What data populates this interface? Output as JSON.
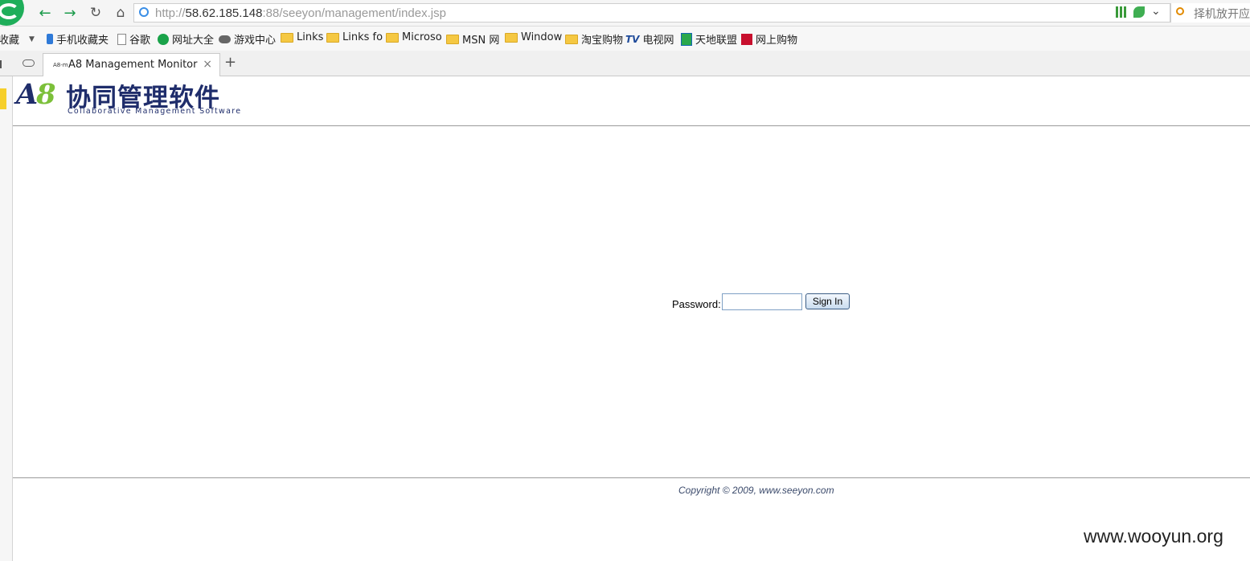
{
  "browser": {
    "url_prefix": "http://",
    "url_host": "58.62.185.148",
    "url_rest": ":88/seeyon/management/index.jsp",
    "search_placeholder": "择机放开应",
    "bookmarks": [
      {
        "label": "收藏",
        "icon": "star-icon"
      },
      {
        "label": "手机收藏夹",
        "icon": "phone-icon"
      },
      {
        "label": "谷歌",
        "icon": "page-icon"
      },
      {
        "label": "网址大全",
        "icon": "plus-globe-icon"
      },
      {
        "label": "游戏中心",
        "icon": "gamepad-icon"
      },
      {
        "label": "Links",
        "icon": "folder-icon"
      },
      {
        "label": "Links fo",
        "icon": "folder-icon"
      },
      {
        "label": "Microso",
        "icon": "folder-icon"
      },
      {
        "label": "MSN 网",
        "icon": "folder-icon"
      },
      {
        "label": "Window",
        "icon": "folder-icon"
      },
      {
        "label": "淘宝购物",
        "icon": "folder-icon"
      },
      {
        "label": "电视网",
        "icon": "tv-icon"
      },
      {
        "label": "天地联盟",
        "icon": "earth-icon"
      },
      {
        "label": "网上购物",
        "icon": "shop-icon"
      }
    ],
    "tab": {
      "title": "A8 Management Monitor",
      "favicon": "A8-m",
      "close": "×"
    },
    "new_tab": "+"
  },
  "header": {
    "logo_mark_a": "A",
    "logo_mark_8": "8",
    "logo_cn": "协同管理软件",
    "logo_en": "Collaborative Management Software"
  },
  "login": {
    "password_label": "Password:",
    "password_value": "",
    "signin_label": "Sign In"
  },
  "footer": {
    "copyright": "Copyright © 2009, www.seeyon.com"
  },
  "watermark": "www.wooyun.org",
  "colors": {
    "brand_navy": "#1f2d6b",
    "brand_green": "#7cc03a",
    "browser_green": "#1aa34a"
  }
}
